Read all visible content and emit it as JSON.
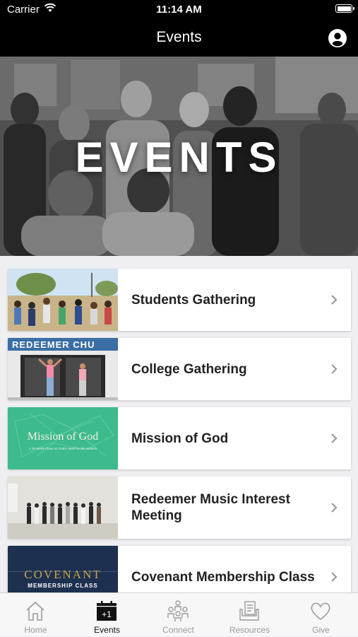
{
  "status_bar": {
    "carrier": "Carrier",
    "time": "11:14 AM"
  },
  "nav": {
    "title": "Events"
  },
  "hero": {
    "text": "EVENTS"
  },
  "events": [
    {
      "title": "Students Gathering"
    },
    {
      "title": "College Gathering",
      "thumb_text": "REDEEMER CHU"
    },
    {
      "title": "Mission of God",
      "thumb_text": "Mission of God",
      "thumb_subtext": "A 10-Week Class on God's Heart for the Nations"
    },
    {
      "title": "Redeemer Music Interest Meeting"
    },
    {
      "title": "Covenant Membership Class",
      "thumb_text": "COVENANT",
      "thumb_subtext": "MEMBERSHIP CLASS"
    }
  ],
  "tabs": [
    {
      "label": "Home",
      "icon": "house-icon"
    },
    {
      "label": "Events",
      "icon": "calendar-plus-one-icon",
      "active": true
    },
    {
      "label": "Connect",
      "icon": "people-group-icon"
    },
    {
      "label": "Resources",
      "icon": "documents-icon"
    },
    {
      "label": "Give",
      "icon": "heart-icon"
    }
  ],
  "colors": {
    "bars": "#000000",
    "mission_green": "#3dbb8c",
    "covenant_navy": "#1d3050",
    "covenant_gold": "#c9a34a",
    "tab_active": "#111111",
    "tab_inactive": "#999999"
  }
}
